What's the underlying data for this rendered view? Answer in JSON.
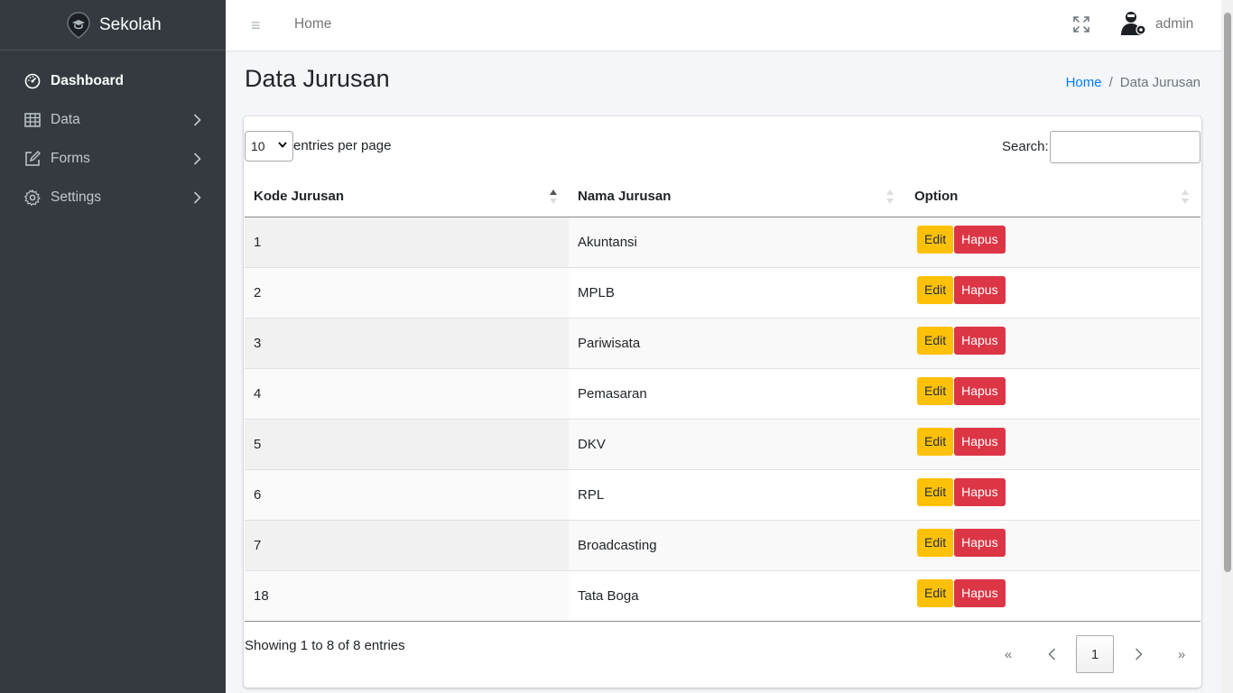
{
  "brand": {
    "name": "Sekolah"
  },
  "sidebar": {
    "items": [
      {
        "label": "Dashboard",
        "icon": "gauge-icon",
        "active": true
      },
      {
        "label": "Data",
        "icon": "table-icon"
      },
      {
        "label": "Forms",
        "icon": "edit-icon"
      },
      {
        "label": "Settings",
        "icon": "gear-icon"
      }
    ]
  },
  "topbar": {
    "home": "Home",
    "user": "admin"
  },
  "page": {
    "title": "Data Jurusan"
  },
  "breadcrumb": {
    "home": "Home",
    "separator": "/",
    "current": "Data Jurusan"
  },
  "table_controls": {
    "length_value": "10",
    "length_text": "entries per page",
    "search_label": "Search:",
    "search_value": ""
  },
  "table": {
    "headers": [
      "Kode Jurusan",
      "Nama Jurusan",
      "Option"
    ],
    "rows": [
      {
        "kode": "1",
        "nama": "Akuntansi"
      },
      {
        "kode": "2",
        "nama": "MPLB"
      },
      {
        "kode": "3",
        "nama": "Pariwisata"
      },
      {
        "kode": "4",
        "nama": "Pemasaran"
      },
      {
        "kode": "5",
        "nama": "DKV"
      },
      {
        "kode": "6",
        "nama": "RPL"
      },
      {
        "kode": "7",
        "nama": "Broadcasting"
      },
      {
        "kode": "18",
        "nama": "Tata Boga"
      }
    ],
    "edit_label": "Edit",
    "delete_label": "Hapus"
  },
  "footer": {
    "info": "Showing 1 to 8 of 8 entries"
  },
  "pagination": {
    "first": "«",
    "prev": "‹",
    "current": "1",
    "next": "›",
    "last": "»"
  },
  "colors": {
    "sidebar": "#343a40",
    "edit": "#ffc107",
    "delete": "#dc3545",
    "link": "#007bff"
  }
}
